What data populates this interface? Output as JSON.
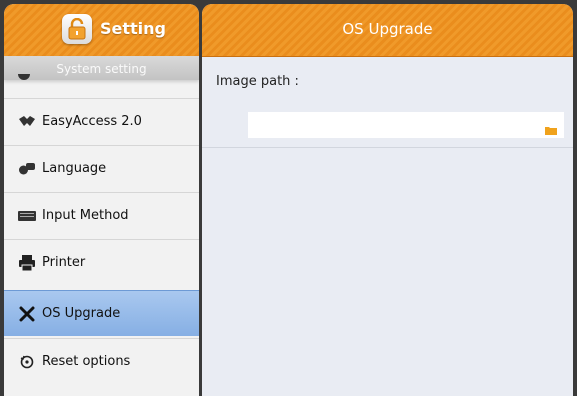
{
  "sidebar": {
    "title": "Setting",
    "section": "System setting",
    "items": [
      {
        "label": "EasyAccess 2.0",
        "icon": "easyaccess-icon"
      },
      {
        "label": "Language",
        "icon": "language-icon"
      },
      {
        "label": "Input Method",
        "icon": "keyboard-icon"
      },
      {
        "label": "Printer",
        "icon": "printer-icon"
      },
      {
        "label": "OS Upgrade",
        "icon": "tools-icon",
        "active": true
      },
      {
        "label": "Reset options",
        "icon": "reset-icon"
      }
    ]
  },
  "main": {
    "title": "OS Upgrade",
    "image_path_label": "Image path :",
    "image_path_value": "",
    "browse_icon": "folder-icon"
  },
  "colors": {
    "header": "#ee951f",
    "active_item": "#9bbfec",
    "panel": "#e9ecf3"
  }
}
